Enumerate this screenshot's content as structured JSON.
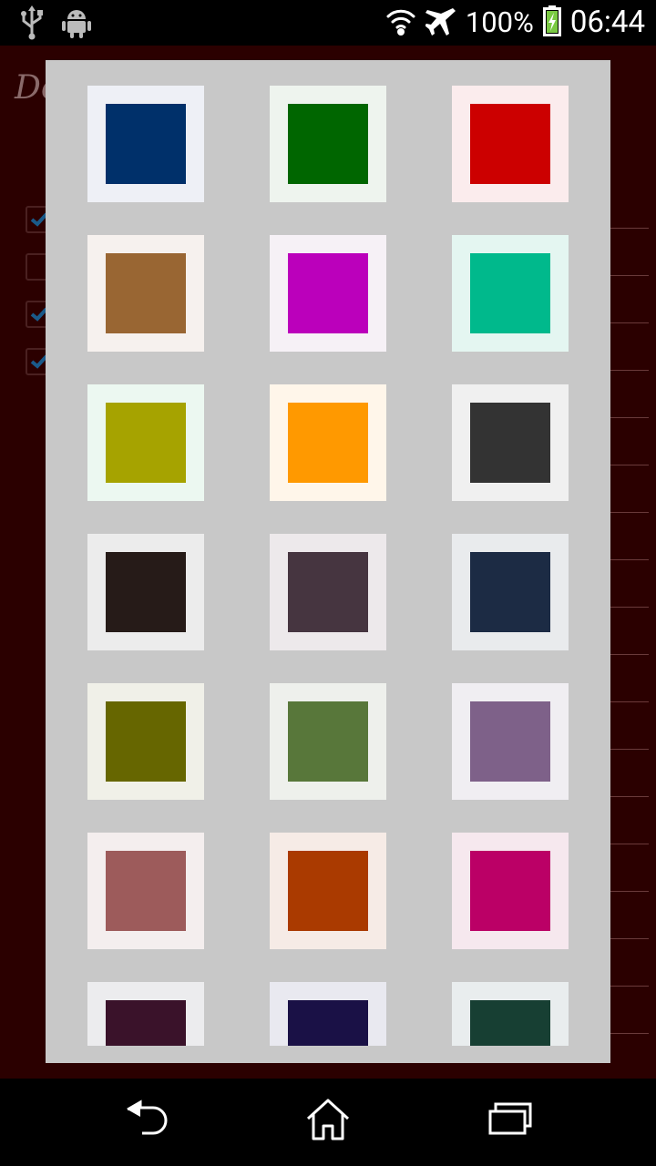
{
  "status_bar": {
    "battery_percent": "100%",
    "time": "06:44",
    "icons": [
      "usb-icon",
      "android-debug-icon",
      "wifi-icon",
      "airplane-mode-icon",
      "battery-charging-icon"
    ]
  },
  "background_app": {
    "title_partial": "De",
    "checkbox_states": [
      true,
      false,
      true,
      true
    ]
  },
  "color_picker": {
    "rows": [
      [
        {
          "name": "navy",
          "color": "#00306a",
          "frame": "#eef0f6"
        },
        {
          "name": "green",
          "color": "#006600",
          "frame": "#eef4ee"
        },
        {
          "name": "red",
          "color": "#cc0000",
          "frame": "#fbeced"
        }
      ],
      [
        {
          "name": "brown",
          "color": "#996633",
          "frame": "#f6f1ee"
        },
        {
          "name": "magenta",
          "color": "#bb00bb",
          "frame": "#f6f1f6"
        },
        {
          "name": "teal",
          "color": "#00b98c",
          "frame": "#e4f6f1"
        }
      ],
      [
        {
          "name": "olive-yellow",
          "color": "#a6a300",
          "frame": "#ecf8f1"
        },
        {
          "name": "orange",
          "color": "#ff9900",
          "frame": "#fff6ea"
        },
        {
          "name": "dark-gray",
          "color": "#333333",
          "frame": "#f0f0f0"
        }
      ],
      [
        {
          "name": "near-black",
          "color": "#261b18",
          "frame": "#ececec"
        },
        {
          "name": "dark-plum",
          "color": "#463540",
          "frame": "#ede9eb"
        },
        {
          "name": "dark-navy",
          "color": "#1c2b44",
          "frame": "#e9ebed"
        }
      ],
      [
        {
          "name": "dark-olive",
          "color": "#666600",
          "frame": "#f0f0e8"
        },
        {
          "name": "moss-green",
          "color": "#58773a",
          "frame": "#eef0ec"
        },
        {
          "name": "muted-purple",
          "color": "#7e6189",
          "frame": "#f0eef2"
        }
      ],
      [
        {
          "name": "dusty-rose",
          "color": "#9d5b5b",
          "frame": "#f4eeee"
        },
        {
          "name": "rust",
          "color": "#aa3a00",
          "frame": "#f6ebe6"
        },
        {
          "name": "raspberry",
          "color": "#bb0066",
          "frame": "#f6e8ee"
        }
      ],
      [
        {
          "name": "dark-wine",
          "color": "#3a122a",
          "frame": "#ececee"
        },
        {
          "name": "midnight-indigo",
          "color": "#1a1146",
          "frame": "#e9e9f0"
        },
        {
          "name": "dark-forest",
          "color": "#173f33",
          "frame": "#e9edee"
        }
      ]
    ]
  },
  "nav_bar": {
    "buttons": [
      "back",
      "home",
      "recent-apps"
    ]
  }
}
